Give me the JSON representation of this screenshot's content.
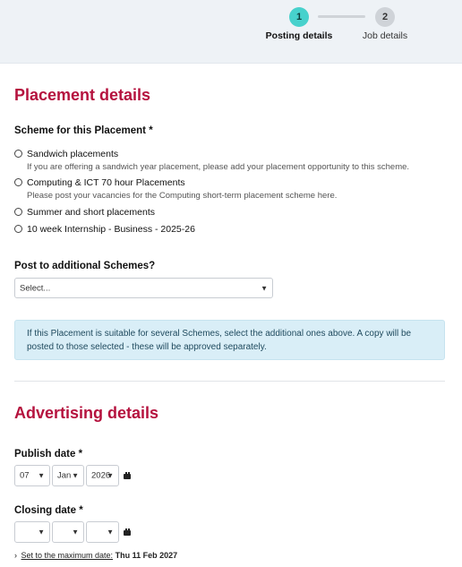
{
  "stepper": {
    "step1": {
      "number": "1",
      "label": "Posting details"
    },
    "step2": {
      "number": "2",
      "label": "Job details"
    }
  },
  "placement": {
    "title": "Placement details",
    "scheme_label": "Scheme for this Placement *",
    "schemes": [
      {
        "label": "Sandwich placements",
        "help": "If you are offering a sandwich year placement, please add your placement opportunity to this scheme."
      },
      {
        "label": "Computing & ICT 70 hour Placements",
        "help": "Please post your vacancies for the Computing short-term placement scheme here."
      },
      {
        "label": "Summer and short placements"
      },
      {
        "label": "10 week Internship - Business - 2025-26"
      }
    ],
    "additional_label": "Post to additional Schemes?",
    "additional_select": "Select...",
    "info_text": "If this Placement is suitable for several Schemes, select the additional ones above. A copy will be posted to those selected - these will be approved separately."
  },
  "advertising": {
    "title": "Advertising details",
    "publish_label": "Publish date *",
    "publish_day": "07",
    "publish_month": "Jan",
    "publish_year": "2026",
    "closing_label": "Closing date *",
    "closing_day": "",
    "closing_month": "",
    "closing_year": "",
    "max_date_link": "Set to the maximum date:",
    "max_date_value": "Thu 11 Feb 2027"
  },
  "colors": {
    "accent": "#b5123e",
    "step_active": "#47d1cc",
    "info_bg": "#d9eef7"
  },
  "icons": {
    "calendar": "calendar-icon",
    "chevron": "chevron-down-icon",
    "arrow": "chevron-right-icon"
  }
}
